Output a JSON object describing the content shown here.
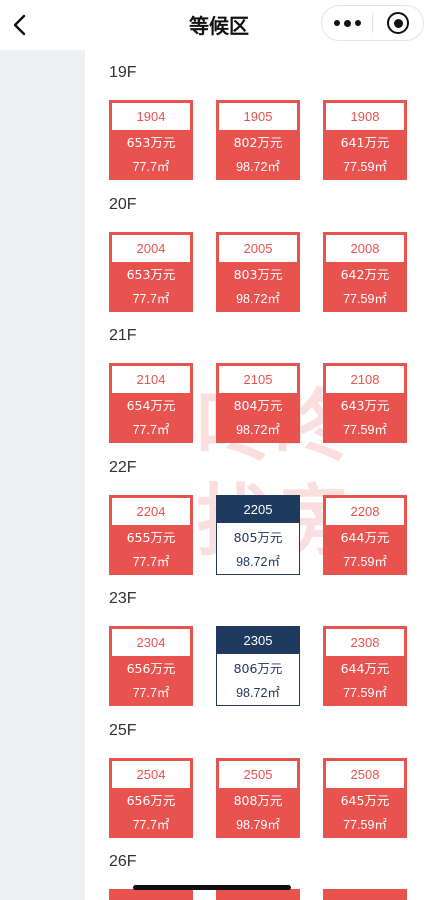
{
  "header": {
    "title": "等候区",
    "back_icon": "chevron-left-icon",
    "more_icon": "more-dots-icon",
    "close_icon": "target-circle-icon"
  },
  "colors": {
    "available": "#e8524f",
    "selected": "#1e3a5f",
    "sidebar": "#eef0f4"
  },
  "floors": [
    {
      "label": "19F",
      "units": [
        {
          "num": "1904",
          "price": "653万元",
          "area": "77.7㎡",
          "state": "available"
        },
        {
          "num": "1905",
          "price": "802万元",
          "area": "98.72㎡",
          "state": "available"
        },
        {
          "num": "1908",
          "price": "641万元",
          "area": "77.59㎡",
          "state": "available"
        }
      ]
    },
    {
      "label": "20F",
      "units": [
        {
          "num": "2004",
          "price": "653万元",
          "area": "77.7㎡",
          "state": "available"
        },
        {
          "num": "2005",
          "price": "803万元",
          "area": "98.72㎡",
          "state": "available"
        },
        {
          "num": "2008",
          "price": "642万元",
          "area": "77.59㎡",
          "state": "available"
        }
      ]
    },
    {
      "label": "21F",
      "units": [
        {
          "num": "2104",
          "price": "654万元",
          "area": "77.7㎡",
          "state": "available"
        },
        {
          "num": "2105",
          "price": "804万元",
          "area": "98.72㎡",
          "state": "available"
        },
        {
          "num": "2108",
          "price": "643万元",
          "area": "77.59㎡",
          "state": "available"
        }
      ]
    },
    {
      "label": "22F",
      "units": [
        {
          "num": "2204",
          "price": "655万元",
          "area": "77.7㎡",
          "state": "available"
        },
        {
          "num": "2205",
          "price": "805万元",
          "area": "98.72㎡",
          "state": "selected"
        },
        {
          "num": "2208",
          "price": "644万元",
          "area": "77.59㎡",
          "state": "available"
        }
      ]
    },
    {
      "label": "23F",
      "units": [
        {
          "num": "2304",
          "price": "656万元",
          "area": "77.7㎡",
          "state": "available"
        },
        {
          "num": "2305",
          "price": "806万元",
          "area": "98.72㎡",
          "state": "selected"
        },
        {
          "num": "2308",
          "price": "644万元",
          "area": "77.59㎡",
          "state": "available"
        }
      ]
    },
    {
      "label": "25F",
      "units": [
        {
          "num": "2504",
          "price": "656万元",
          "area": "77.7㎡",
          "state": "available"
        },
        {
          "num": "2505",
          "price": "808万元",
          "area": "98.79㎡",
          "state": "available"
        },
        {
          "num": "2508",
          "price": "645万元",
          "area": "77.59㎡",
          "state": "available"
        }
      ]
    },
    {
      "label": "26F",
      "units": []
    }
  ],
  "watermark": {
    "line1": "咚咚",
    "line2": "找房"
  }
}
